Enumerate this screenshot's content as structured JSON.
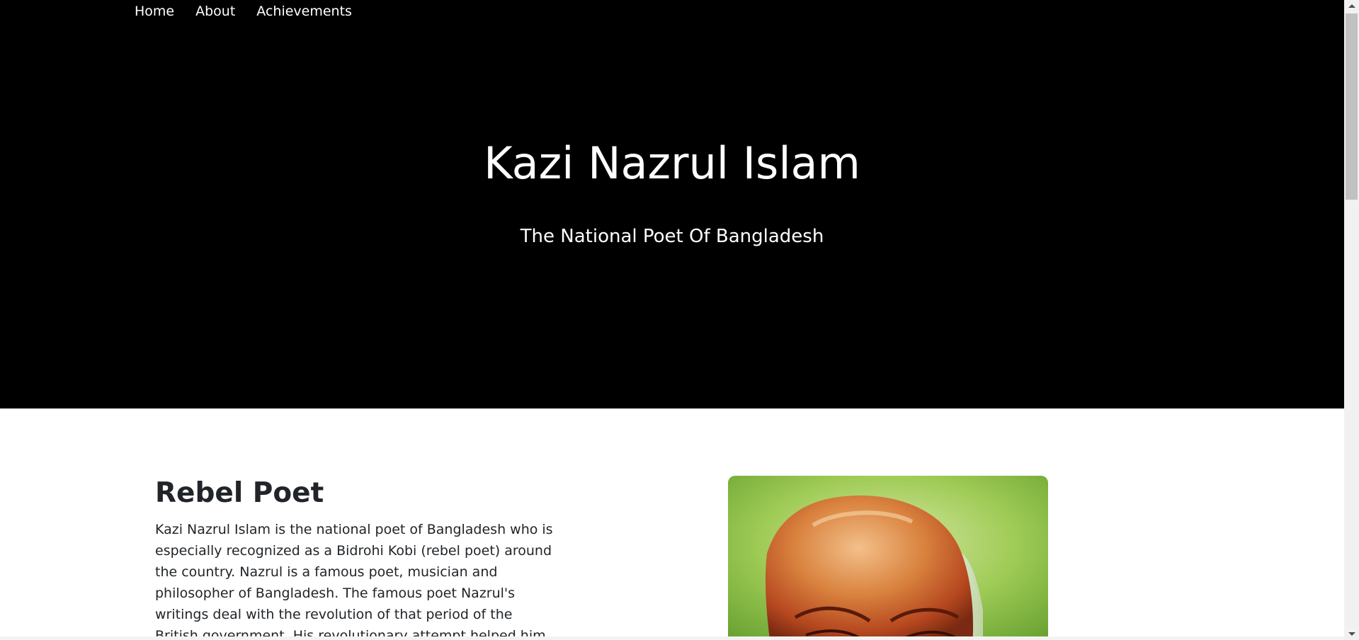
{
  "nav": {
    "items": [
      {
        "label": "Home"
      },
      {
        "label": "About"
      },
      {
        "label": "Achievements"
      }
    ]
  },
  "hero": {
    "title": "Kazi Nazrul Islam",
    "subtitle": "The National Poet Of Bangladesh"
  },
  "about": {
    "title": "Rebel Poet",
    "text": "Kazi Nazrul Islam is the national poet of Bangladesh who is especially recognized as a Bidrohi Kobi (rebel poet) around the country. Nazrul is a famous poet, musician and philosopher of Bangladesh. The famous poet Nazrul's writings deal with the revolution of that period of the British government. His revolutionary attempt helped him to be a national poet of"
  },
  "colors": {
    "hero_bg": "#000000",
    "text_dark": "#212529",
    "page_bg": "#ffffff"
  }
}
